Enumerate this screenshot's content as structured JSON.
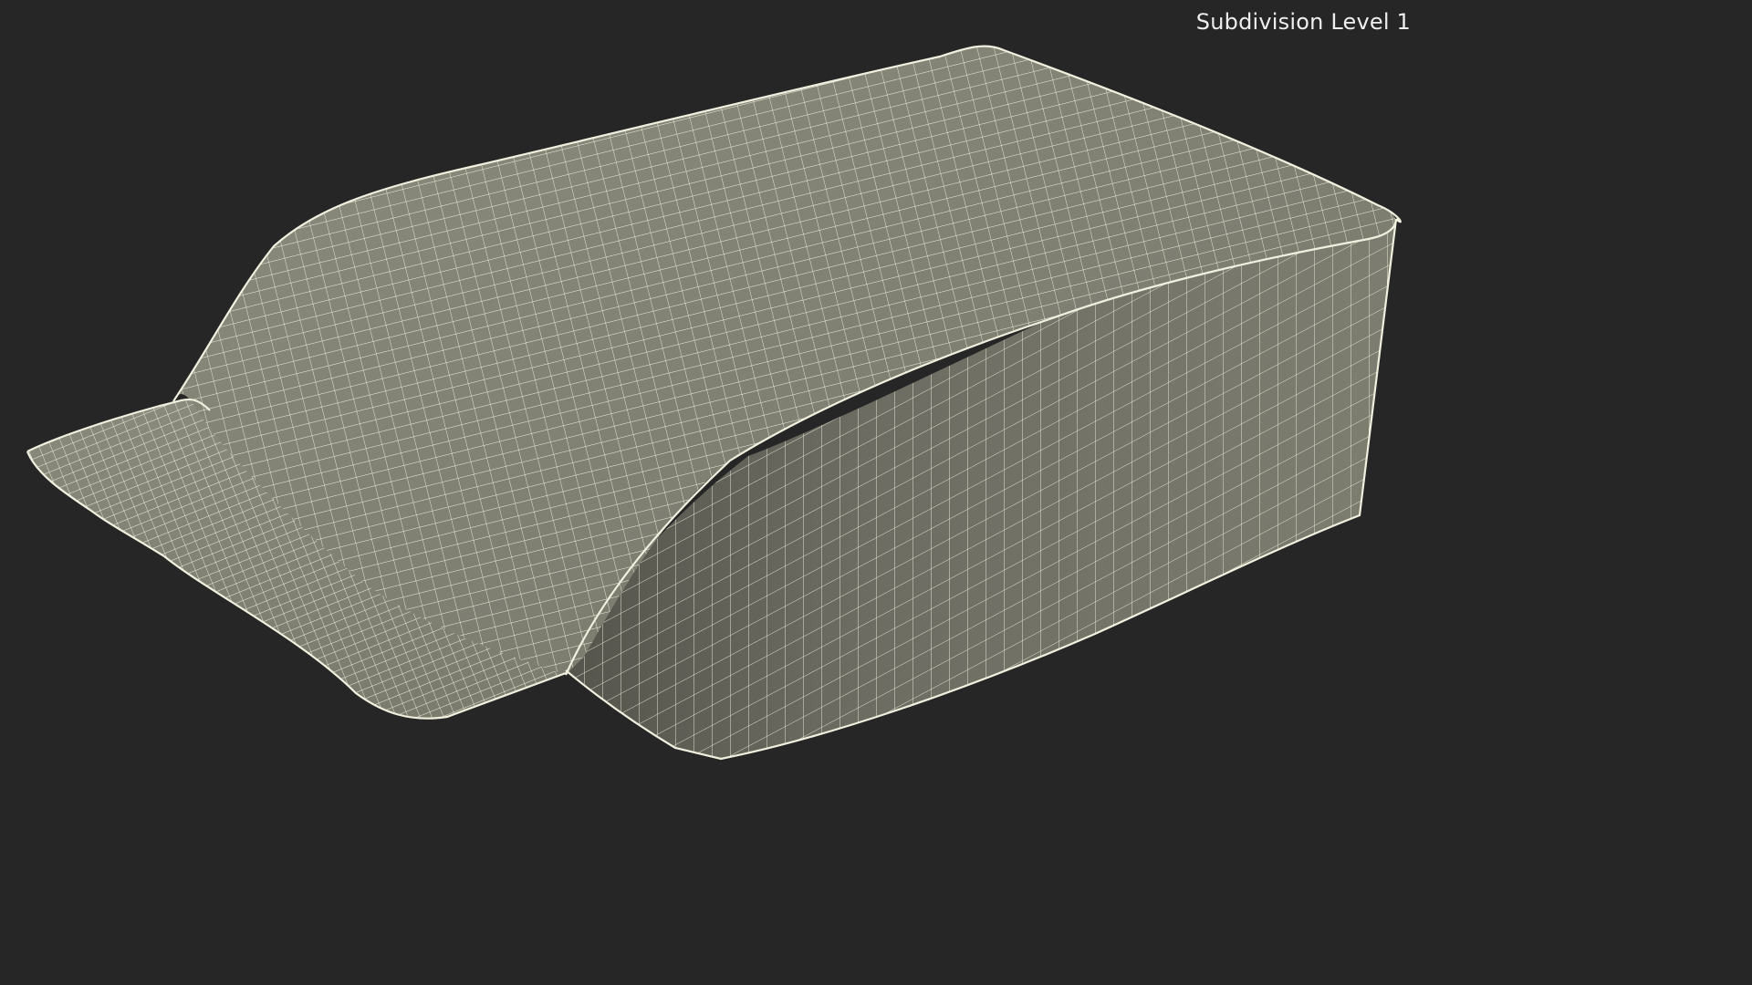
{
  "overlay": {
    "label": "Subdivision Level 1"
  },
  "scene": {
    "model_icon": "wireframe-pouch-model",
    "colors": {
      "background": "#262626",
      "surface_light": "#8a8a7c",
      "surface_mid": "#7a7a6d",
      "surface_dark": "#5e5e55",
      "wire": "#f1f0df",
      "label": "#eeeeee"
    }
  }
}
